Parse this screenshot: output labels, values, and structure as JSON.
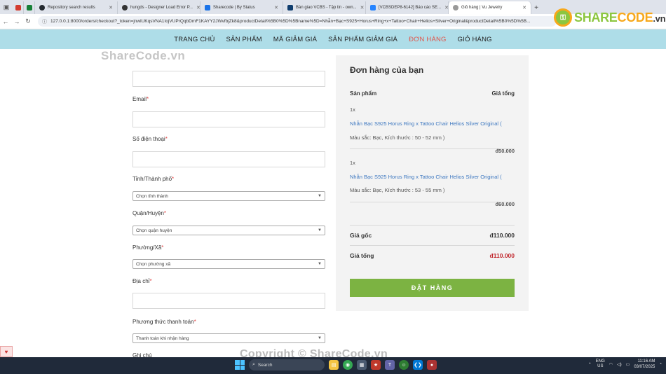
{
  "browser": {
    "tabs": [
      {
        "label": "",
        "color": "#d33c2f"
      },
      {
        "label": "",
        "color": "#188038"
      },
      {
        "label": "Repository search results",
        "color": "#24292f"
      },
      {
        "label": "hungds - Designer Load Error P...",
        "color": "#333333"
      },
      {
        "label": "Sharecode | By Status",
        "color": "#1a73e8"
      },
      {
        "label": "Bàn giao VCBS - Tập tin - own...",
        "color": "#0f3d6e"
      },
      {
        "label": "[VCBSDEP8-6142] Báo cáo SE...",
        "color": "#2684ff"
      },
      {
        "label": "Giỏ hàng | Vu Jewelry",
        "color": "#999999"
      }
    ],
    "url": "127.0.0.1:8000/orders/checkout?_token=jnwlUKqsVNA1IojVUPrQqbDmF1KAYY2JWvfbjZk8&productDetail%5B0%5D%5Bname%5D=Nhẫn+Bạc+S925+Horus+Ring+x+Tattoo+Chair+Helios+Silver+Original&productDetail%5B0%5D%5B..."
  },
  "nav": {
    "items": [
      "TRANG CHỦ",
      "SẢN PHẨM",
      "MÃ GIẢM GIÁ",
      "SẢN PHẨM GIẢM GIÁ",
      "ĐƠN HÀNG",
      "GIỎ HÀNG"
    ],
    "active_index": 4
  },
  "watermark": {
    "top": "ShareCode.vn",
    "bottom": "Copyright © ShareCode.vn",
    "logo_main": "SHARE",
    "logo_accent": "CODE",
    "logo_tld": ".vn"
  },
  "form": {
    "email_label": "Email",
    "phone_label": "Số điện thoại",
    "province_label": "Tỉnh/Thành phố",
    "province_value": "Chọn tỉnh thành",
    "district_label": "Quận/Huyện",
    "district_value": "Chọn quận huyện",
    "ward_label": "Phường/Xã",
    "ward_value": "Chọn phường xã",
    "address_label": "Địa chỉ",
    "payment_label": "Phương thức thanh toán",
    "payment_value": "Thanh toán khi nhận hàng",
    "note_label": "Ghi chú",
    "required_mark": "*"
  },
  "order": {
    "title": "Đơn hàng của bạn",
    "col_product": "Sản phẩm",
    "col_total": "Giá tổng",
    "items": [
      {
        "qty": "1x",
        "name": "Nhẫn Bạc S925 Horus Ring x Tattoo Chair Helios Silver Original (",
        "attrs": "Màu sắc: Bạc, Kích thước : 50 - 52 mm )",
        "price": "đ50.000"
      },
      {
        "qty": "1x",
        "name": "Nhẫn Bạc S925 Horus Ring x Tattoo Chair Helios Silver Original (",
        "attrs": "Màu sắc: Bạc, Kích thước : 53 - 55 mm )",
        "price": "đ60.000"
      }
    ],
    "subtotal_label": "Giá gốc",
    "subtotal_value": "đ110.000",
    "total_label": "Giá tổng",
    "total_value": "đ110.000",
    "submit_label": "ĐẶT HÀNG"
  },
  "taskbar": {
    "search_placeholder": "Search",
    "lang_top": "ENG",
    "lang_bottom": "US",
    "time": "11:16 AM",
    "date": "03/07/2025"
  }
}
